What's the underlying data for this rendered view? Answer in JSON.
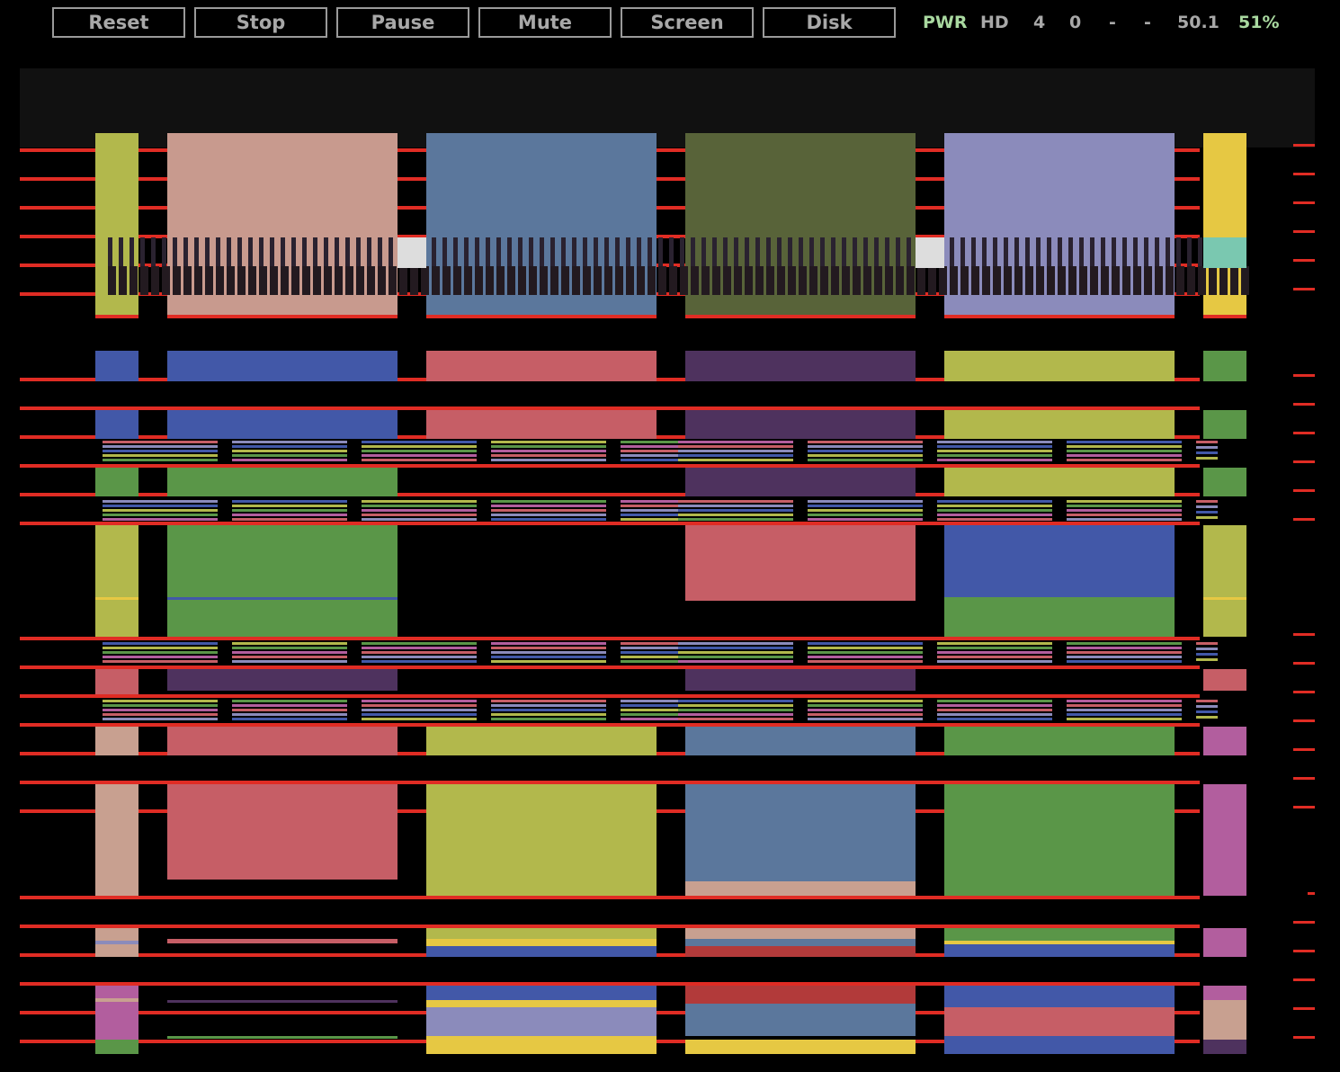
{
  "toolbar": {
    "buttons": [
      {
        "label": "Reset"
      },
      {
        "label": "Stop"
      },
      {
        "label": "Pause"
      },
      {
        "label": "Mute"
      },
      {
        "label": "Screen"
      },
      {
        "label": "Disk"
      }
    ]
  },
  "status": {
    "power": "PWR",
    "hd": "HD",
    "val1": "4",
    "val2": "0",
    "dash1": "-",
    "dash2": "-",
    "speed": "50.1",
    "percent": "51%"
  },
  "colors": {
    "scanline": "#e02c24",
    "status_green": "#a9d9a0",
    "button_text": "#a8a8a8",
    "palette": [
      "#b2b84c",
      "#c89a8e",
      "#5b779c",
      "#586339",
      "#8b8bbb",
      "#e6c843",
      "#4258a8",
      "#c65e66",
      "#4e325e",
      "#5a9648",
      "#b25e9e",
      "#c8a090",
      "#b23a3a"
    ]
  }
}
